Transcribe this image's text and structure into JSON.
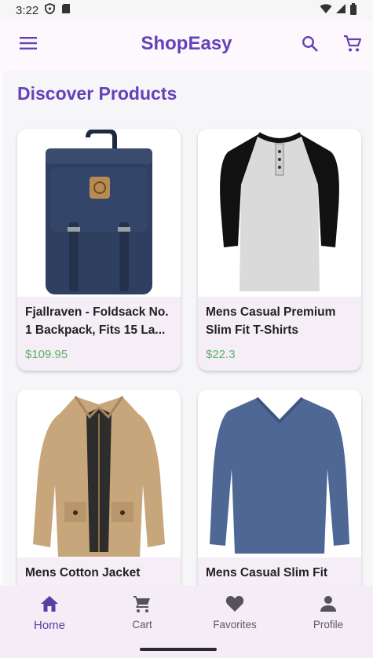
{
  "status": {
    "time": "3:22"
  },
  "app": {
    "title": "ShopEasy"
  },
  "section": {
    "title": "Discover Products"
  },
  "products": [
    {
      "title": "Fjallraven - Foldsack No. 1 Backpack, Fits 15 La...",
      "price": "$109.95",
      "image": "backpack"
    },
    {
      "title": "Mens Casual Premium Slim Fit T-Shirts",
      "price": "$22.3",
      "image": "raglan-tshirt"
    },
    {
      "title": "Mens Cotton Jacket",
      "price": "",
      "image": "jacket"
    },
    {
      "title": "Mens Casual Slim Fit",
      "price": "",
      "image": "longsleeve-shirt"
    }
  ],
  "nav": [
    {
      "label": "Home",
      "icon": "home-icon",
      "active": true
    },
    {
      "label": "Cart",
      "icon": "cart-icon",
      "active": false
    },
    {
      "label": "Favorites",
      "icon": "heart-icon",
      "active": false
    },
    {
      "label": "Profile",
      "icon": "person-icon",
      "active": false
    }
  ],
  "colors": {
    "accent": "#6541b8",
    "price": "#5fb067",
    "nav_bg": "#f4ecf6"
  }
}
